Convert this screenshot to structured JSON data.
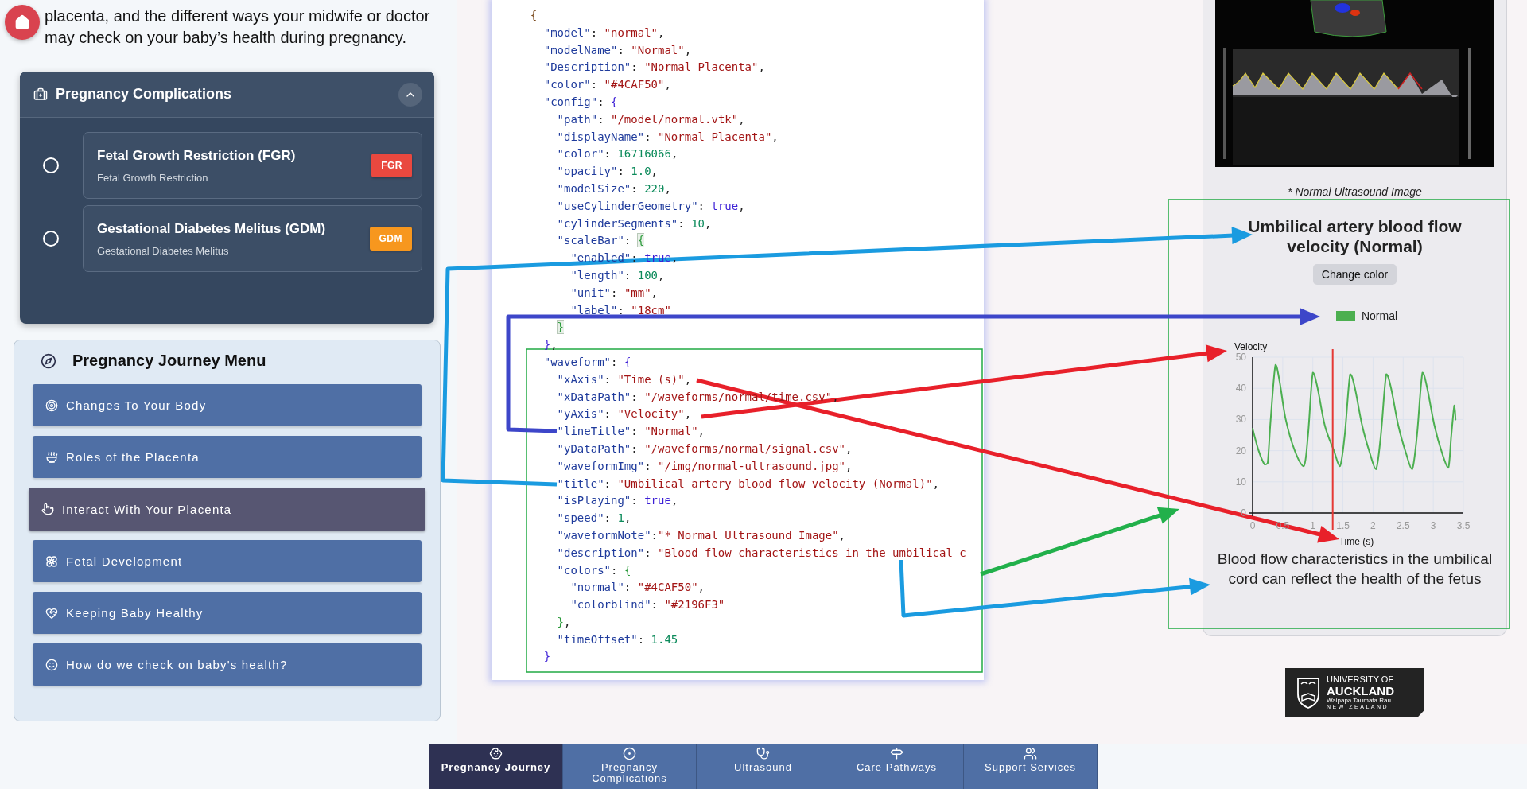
{
  "intro": "placenta, and the different ways your midwife or doctor may check on your baby’s health during pregnancy.",
  "complications_panel": {
    "title": "Pregnancy Complications",
    "expanded": true,
    "items": [
      {
        "title": "Fetal Growth Restriction (FGR)",
        "subtitle": "Fetal Growth Restriction",
        "badge": "FGR",
        "color": "#e9483f",
        "selected": false
      },
      {
        "title": "Gestational Diabetes Melitus (GDM)",
        "subtitle": "Gestational Diabetes Melitus",
        "badge": "GDM",
        "color": "#f7971e",
        "selected": false
      }
    ]
  },
  "journey_menu": {
    "title": "Pregnancy Journey Menu",
    "items": [
      {
        "label": "Changes To Your Body",
        "selected": false
      },
      {
        "label": "Roles of the Placenta",
        "selected": false
      },
      {
        "label": "Interact With Your Placenta",
        "selected": true
      },
      {
        "label": "Fetal Development",
        "selected": false
      },
      {
        "label": "Keeping Baby Healthy",
        "selected": false
      },
      {
        "label": "How do we check on baby's health?",
        "selected": false
      }
    ]
  },
  "code_editor": {
    "lines": [
      [
        {
          "kind": "b1",
          "text": "  {"
        }
      ],
      [
        {
          "kind": "key",
          "text": "    \"model\""
        },
        {
          "kind": "p",
          "text": ": "
        },
        {
          "kind": "str",
          "text": "\"normal\""
        },
        {
          "kind": "p",
          "text": ","
        }
      ],
      [
        {
          "kind": "key",
          "text": "    \"modelName\""
        },
        {
          "kind": "p",
          "text": ": "
        },
        {
          "kind": "str",
          "text": "\"Normal\""
        },
        {
          "kind": "p",
          "text": ","
        }
      ],
      [
        {
          "kind": "key",
          "text": "    \"Description\""
        },
        {
          "kind": "p",
          "text": ": "
        },
        {
          "kind": "str",
          "text": "\"Normal Placenta\""
        },
        {
          "kind": "p",
          "text": ","
        }
      ],
      [
        {
          "kind": "key",
          "text": "    \"color\""
        },
        {
          "kind": "p",
          "text": ": "
        },
        {
          "kind": "str",
          "text": "\"#4CAF50\""
        },
        {
          "kind": "p",
          "text": ","
        }
      ],
      [
        {
          "kind": "key",
          "text": "    \"config\""
        },
        {
          "kind": "p",
          "text": ": "
        },
        {
          "kind": "b2",
          "text": "{"
        }
      ],
      [
        {
          "kind": "key",
          "text": "      \"path\""
        },
        {
          "kind": "p",
          "text": ": "
        },
        {
          "kind": "str",
          "text": "\"/model/normal.vtk\""
        },
        {
          "kind": "p",
          "text": ","
        }
      ],
      [
        {
          "kind": "key",
          "text": "      \"displayName\""
        },
        {
          "kind": "p",
          "text": ": "
        },
        {
          "kind": "str",
          "text": "\"Normal Placenta\""
        },
        {
          "kind": "p",
          "text": ","
        }
      ],
      [
        {
          "kind": "key",
          "text": "      \"color\""
        },
        {
          "kind": "p",
          "text": ": "
        },
        {
          "kind": "num",
          "text": "16716066"
        },
        {
          "kind": "p",
          "text": ","
        }
      ],
      [
        {
          "kind": "key",
          "text": "      \"opacity\""
        },
        {
          "kind": "p",
          "text": ": "
        },
        {
          "kind": "num",
          "text": "1.0"
        },
        {
          "kind": "p",
          "text": ","
        }
      ],
      [
        {
          "kind": "key",
          "text": "      \"modelSize\""
        },
        {
          "kind": "p",
          "text": ": "
        },
        {
          "kind": "num",
          "text": "220"
        },
        {
          "kind": "p",
          "text": ","
        }
      ],
      [
        {
          "kind": "key",
          "text": "      \"useCylinderGeometry\""
        },
        {
          "kind": "p",
          "text": ": "
        },
        {
          "kind": "kw",
          "text": "true"
        },
        {
          "kind": "p",
          "text": ","
        }
      ],
      [
        {
          "kind": "key",
          "text": "      \"cylinderSegments\""
        },
        {
          "kind": "p",
          "text": ": "
        },
        {
          "kind": "num",
          "text": "10"
        },
        {
          "kind": "p",
          "text": ","
        }
      ],
      [
        {
          "kind": "key",
          "text": "      \"scaleBar\""
        },
        {
          "kind": "p",
          "text": ": "
        },
        {
          "kind": "m",
          "text": "{"
        }
      ],
      [
        {
          "kind": "key",
          "text": "        \"enabled\""
        },
        {
          "kind": "p",
          "text": ": "
        },
        {
          "kind": "kw",
          "text": "true"
        },
        {
          "kind": "p",
          "text": ","
        }
      ],
      [
        {
          "kind": "key",
          "text": "        \"length\""
        },
        {
          "kind": "p",
          "text": ": "
        },
        {
          "kind": "num",
          "text": "100"
        },
        {
          "kind": "p",
          "text": ","
        }
      ],
      [
        {
          "kind": "key",
          "text": "        \"unit\""
        },
        {
          "kind": "p",
          "text": ": "
        },
        {
          "kind": "str",
          "text": "\"mm\""
        },
        {
          "kind": "p",
          "text": ","
        }
      ],
      [
        {
          "kind": "key",
          "text": "        \"label\""
        },
        {
          "kind": "p",
          "text": ": "
        },
        {
          "kind": "str",
          "text": "\"18cm\""
        }
      ],
      [
        {
          "kind": "m",
          "text": "      }"
        }
      ],
      [
        {
          "kind": "b2",
          "text": "    }"
        },
        {
          "kind": "p",
          "text": ","
        }
      ],
      [
        {
          "kind": "key",
          "text": "    \"waveform\""
        },
        {
          "kind": "p",
          "text": ": "
        },
        {
          "kind": "b2",
          "text": "{"
        }
      ],
      [
        {
          "kind": "key",
          "text": "      \"xAxis\""
        },
        {
          "kind": "p",
          "text": ": "
        },
        {
          "kind": "str",
          "text": "\"Time (s)\""
        },
        {
          "kind": "p",
          "text": ","
        }
      ],
      [
        {
          "kind": "key",
          "text": "      \"xDataPath\""
        },
        {
          "kind": "p",
          "text": ": "
        },
        {
          "kind": "str",
          "text": "\"/waveforms/normal/time.csv\""
        },
        {
          "kind": "p",
          "text": ","
        }
      ],
      [
        {
          "kind": "key",
          "text": "      \"yAxis\""
        },
        {
          "kind": "p",
          "text": ": "
        },
        {
          "kind": "str",
          "text": "\"Velocity\""
        },
        {
          "kind": "p",
          "text": ","
        }
      ],
      [
        {
          "kind": "key",
          "text": "      \"lineTitle\""
        },
        {
          "kind": "p",
          "text": ": "
        },
        {
          "kind": "str",
          "text": "\"Normal\""
        },
        {
          "kind": "p",
          "text": ","
        }
      ],
      [
        {
          "kind": "key",
          "text": "      \"yDataPath\""
        },
        {
          "kind": "p",
          "text": ": "
        },
        {
          "kind": "str",
          "text": "\"/waveforms/normal/signal.csv\""
        },
        {
          "kind": "p",
          "text": ","
        }
      ],
      [
        {
          "kind": "key",
          "text": "      \"waveformImg\""
        },
        {
          "kind": "p",
          "text": ": "
        },
        {
          "kind": "str",
          "text": "\"/img/normal-ultrasound.jpg\""
        },
        {
          "kind": "p",
          "text": ","
        }
      ],
      [
        {
          "kind": "key",
          "text": "      \"title\""
        },
        {
          "kind": "p",
          "text": ": "
        },
        {
          "kind": "str",
          "text": "\"Umbilical artery blood flow velocity (Normal)\""
        },
        {
          "kind": "p",
          "text": ","
        }
      ],
      [
        {
          "kind": "key",
          "text": "      \"isPlaying\""
        },
        {
          "kind": "p",
          "text": ": "
        },
        {
          "kind": "kw",
          "text": "true"
        },
        {
          "kind": "p",
          "text": ","
        }
      ],
      [
        {
          "kind": "key",
          "text": "      \"speed\""
        },
        {
          "kind": "p",
          "text": ": "
        },
        {
          "kind": "num",
          "text": "1"
        },
        {
          "kind": "p",
          "text": ","
        }
      ],
      [
        {
          "kind": "key",
          "text": "      \"waveformNote\""
        },
        {
          "kind": "p",
          "text": ":"
        },
        {
          "kind": "str",
          "text": "\"* Normal Ultrasound Image\""
        },
        {
          "kind": "p",
          "text": ","
        }
      ],
      [
        {
          "kind": "key",
          "text": "      \"description\""
        },
        {
          "kind": "p",
          "text": ": "
        },
        {
          "kind": "str",
          "text": "\"Blood flow characteristics in the umbilical c"
        }
      ],
      [
        {
          "kind": "key",
          "text": "      \"colors\""
        },
        {
          "kind": "p",
          "text": ": "
        },
        {
          "kind": "b3",
          "text": "{"
        }
      ],
      [
        {
          "kind": "key",
          "text": "        \"normal\""
        },
        {
          "kind": "p",
          "text": ": "
        },
        {
          "kind": "str",
          "text": "\"#4CAF50\""
        },
        {
          "kind": "p",
          "text": ","
        }
      ],
      [
        {
          "kind": "key",
          "text": "        \"colorblind\""
        },
        {
          "kind": "p",
          "text": ": "
        },
        {
          "kind": "str",
          "text": "\"#2196F3\""
        }
      ],
      [
        {
          "kind": "b3",
          "text": "      }"
        },
        {
          "kind": "p",
          "text": ","
        }
      ],
      [
        {
          "kind": "key",
          "text": "      \"timeOffset\""
        },
        {
          "kind": "p",
          "text": ": "
        },
        {
          "kind": "num",
          "text": "1.45"
        }
      ],
      [
        {
          "kind": "b2",
          "text": "    }"
        }
      ]
    ]
  },
  "waveform_card": {
    "note": "* Normal Ultrasound Image",
    "title": "Umbilical artery blood flow velocity (Normal)",
    "button": "Change color",
    "chart_data": {
      "type": "line",
      "xlabel": "Time (s)",
      "ylabel": "Velocity",
      "x": [
        0,
        0.1,
        0.2,
        0.25,
        0.3,
        0.38,
        0.45,
        0.55,
        0.7,
        0.85,
        0.92,
        1.0,
        1.08,
        1.2,
        1.35,
        1.45,
        1.53,
        1.62,
        1.7,
        1.82,
        1.95,
        2.05,
        2.13,
        2.22,
        2.3,
        2.42,
        2.55,
        2.65,
        2.73,
        2.82,
        2.9,
        3.02,
        3.15,
        3.25,
        3.3,
        3.35,
        3.37
      ],
      "series": [
        {
          "name": "Normal",
          "color": "#4caf50",
          "values": [
            27,
            20,
            15.5,
            16,
            30,
            47.5,
            42,
            30,
            20,
            15,
            25,
            45,
            40,
            28,
            20,
            15,
            25,
            44.5,
            40,
            28,
            19,
            14,
            25,
            44.5,
            40,
            28,
            19,
            14,
            25,
            45,
            40,
            28,
            19,
            14.5,
            25,
            34.5,
            30
          ]
        }
      ],
      "xlim": [
        0,
        3.5
      ],
      "ylim": [
        0,
        50
      ],
      "xticks": [
        0,
        0.5,
        1,
        1.5,
        2,
        2.5,
        3,
        3.5
      ],
      "yticks": [
        0,
        10,
        20,
        30,
        40,
        50
      ],
      "grid": true,
      "ref_lines": [
        {
          "axis": "x",
          "value": 1.33
        }
      ]
    },
    "description": "Blood flow characteristics in the umbilical cord can reflect the health of the fetus"
  },
  "logo": {
    "lines": [
      "UNIVERSITY OF",
      "AUCKLAND",
      "Waipapa Taumata Rau",
      "NEW ZEALAND"
    ]
  },
  "bottom_nav": [
    {
      "label": "Pregnancy Journey",
      "selected": true
    },
    {
      "label": "Pregnancy Complications",
      "selected": false
    },
    {
      "label": "Ultrasound",
      "selected": false
    },
    {
      "label": "Care Pathways",
      "selected": false
    },
    {
      "label": "Support Services",
      "selected": false
    }
  ]
}
